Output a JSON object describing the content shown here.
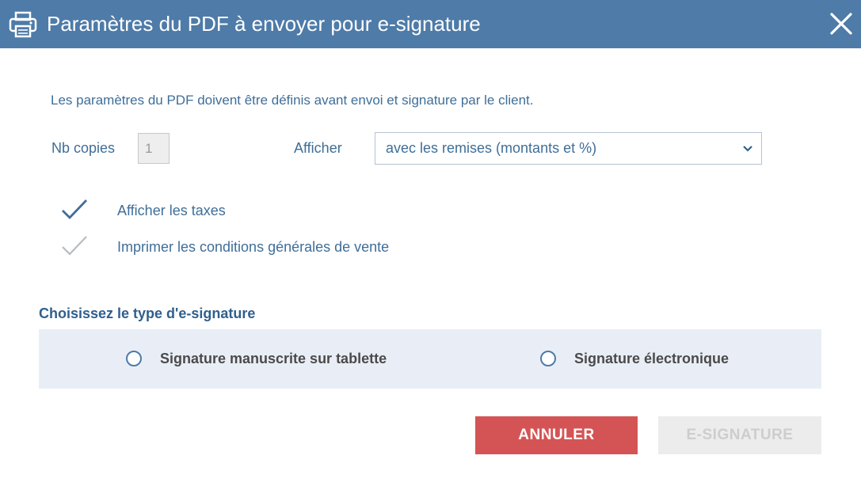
{
  "dialog": {
    "title": "Paramètres du PDF à envoyer pour e-signature",
    "icons": {
      "header": "printer-icon",
      "close": "close-icon"
    },
    "colors": {
      "header_bg": "#4e7ba8",
      "text": "#3f6e98",
      "cancel_bg": "#d45455",
      "disabled_bg": "#ececec"
    }
  },
  "form": {
    "intro": "Les paramètres du PDF doivent être définis avant envoi et signature par le client.",
    "copies": {
      "label": "Nb copies",
      "value": "1"
    },
    "display": {
      "label": "Afficher",
      "selected": "avec les remises (montants et %)"
    },
    "options": [
      {
        "label": "Afficher les taxes",
        "checked": true
      },
      {
        "label": "Imprimer les conditions générales de vente",
        "checked": false
      }
    ]
  },
  "signature": {
    "title": "Choisissez le type d'e-signature",
    "choices": [
      {
        "label": "Signature manuscrite sur tablette",
        "selected": false
      },
      {
        "label": "Signature électronique",
        "selected": false
      }
    ]
  },
  "buttons": {
    "cancel": "ANNULER",
    "esign": "E-SIGNATURE",
    "esign_disabled": true
  }
}
